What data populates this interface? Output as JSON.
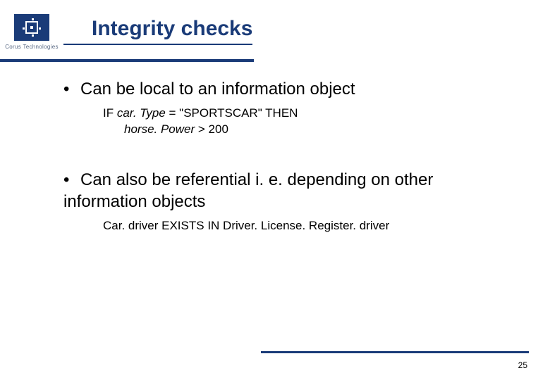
{
  "brand": {
    "name": "Corus Technologies"
  },
  "title": "Integrity checks",
  "bullets": [
    {
      "text": "Can be local to an information object",
      "sub": {
        "line1_prefix": "IF ",
        "line1_italic": "car. Type",
        "line1_suffix": " = \"SPORTSCAR\" THEN",
        "line2_italic": "horse. Power",
        "line2_suffix": " > 200"
      }
    },
    {
      "text": "Can also be referential i. e. depending on other information objects",
      "sub": {
        "line1": "Car. driver EXISTS IN Driver. License. Register. driver"
      }
    }
  ],
  "page_number": "25"
}
